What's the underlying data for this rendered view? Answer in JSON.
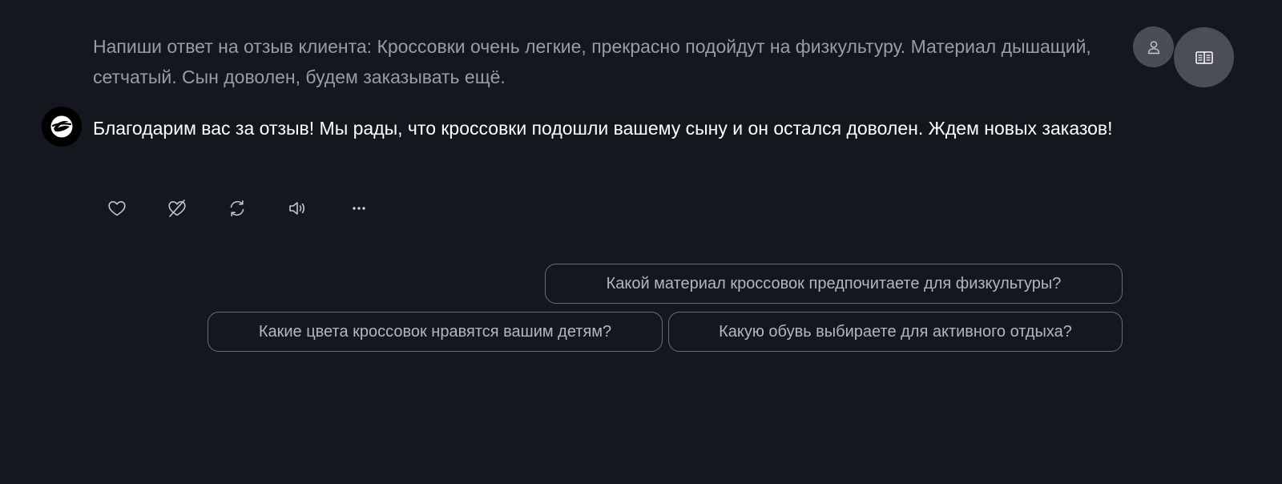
{
  "conversation": {
    "user_message": "Напиши ответ на отзыв клиента: Кроссовки очень легкие, прекрасно подойдут на физкультуру. Материал дышащий, сетчатый. Сын доволен, будем заказывать ещё.",
    "bot_message": "Благодарим вас за отзыв! Мы рады, что кроссовки подошли вашему сыну и он остался доволен. Ждем новых заказов!"
  },
  "message_actions": [
    {
      "icon": "heart-icon"
    },
    {
      "icon": "dislike-heart-icon"
    },
    {
      "icon": "regenerate-icon"
    },
    {
      "icon": "speaker-icon"
    },
    {
      "icon": "more-icon"
    }
  ],
  "suggestions": [
    "Какой материал кроссовок предпочитаете для физкультуры?",
    "Какие цвета кроссовок нравятся вашим детям?",
    "Какую обувь выбираете для активного отдыха?"
  ],
  "header": {
    "user_avatar_icon": "user-icon",
    "reader_icon": "book-icon"
  },
  "colors": {
    "background": "#15171f",
    "user_text": "#9a9ca3",
    "bot_text": "#ffffff",
    "chip_border": "#6a6d76",
    "avatar_bg": "#4a4d57"
  }
}
